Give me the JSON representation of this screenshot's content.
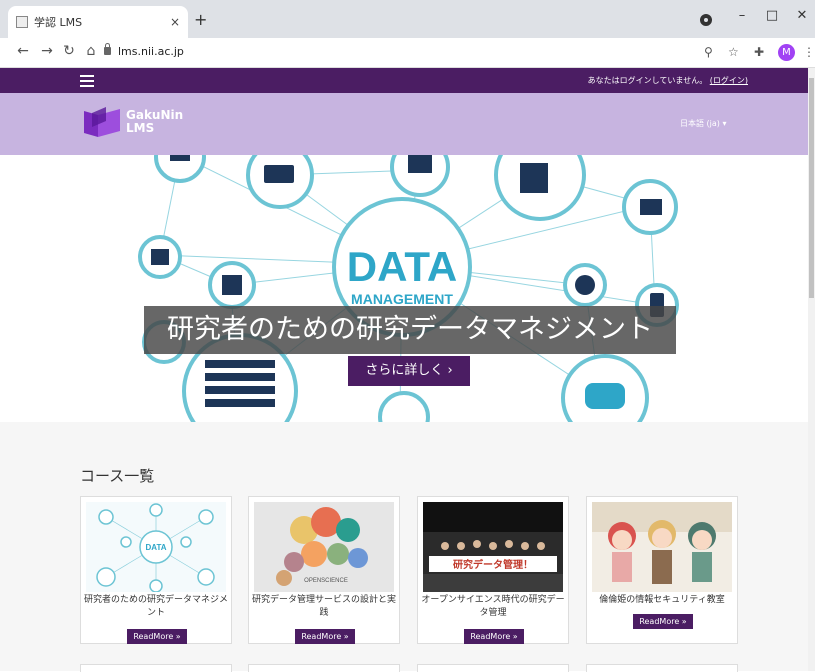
{
  "browser": {
    "tab_title": "学認 LMS",
    "tab_close": "×",
    "new_tab": "+",
    "url": "lms.nii.ac.jp",
    "avatar_letter": "M",
    "window_controls": [
      "–",
      "□",
      "✕"
    ]
  },
  "site": {
    "login_text": "あなたはログインしていません。",
    "login_link": "(ログイン)",
    "brand_line1": "GakuNin",
    "brand_line2": "LMS",
    "language": "日本語 (ja) ▾",
    "colors": {
      "nav": "#4b1d63",
      "brand_bar": "#c7b4e0",
      "accent": "#4b1d63"
    }
  },
  "hero": {
    "center_line1": "DATA",
    "center_line2": "MANAGEMENT",
    "caption": "研究者のための研究データマネジメント",
    "more_button": "さらに詳しく ›"
  },
  "courses": {
    "section_title": "コース一覧",
    "items": [
      {
        "title": "研究者のための研究データマネジメント",
        "button": "ReadMore »",
        "image_label": "DATA"
      },
      {
        "title": "研究データ管理サービスの設計と実践",
        "button": "ReadMore »",
        "image_label": "OPENSCIENCE"
      },
      {
        "title": "オープンサイエンス時代の研究データ管理",
        "button": "ReadMore »",
        "image_label": "研究データ管理！"
      },
      {
        "title": "倫倫姫の情報セキュリティ教室",
        "button": "ReadMore »"
      }
    ]
  }
}
